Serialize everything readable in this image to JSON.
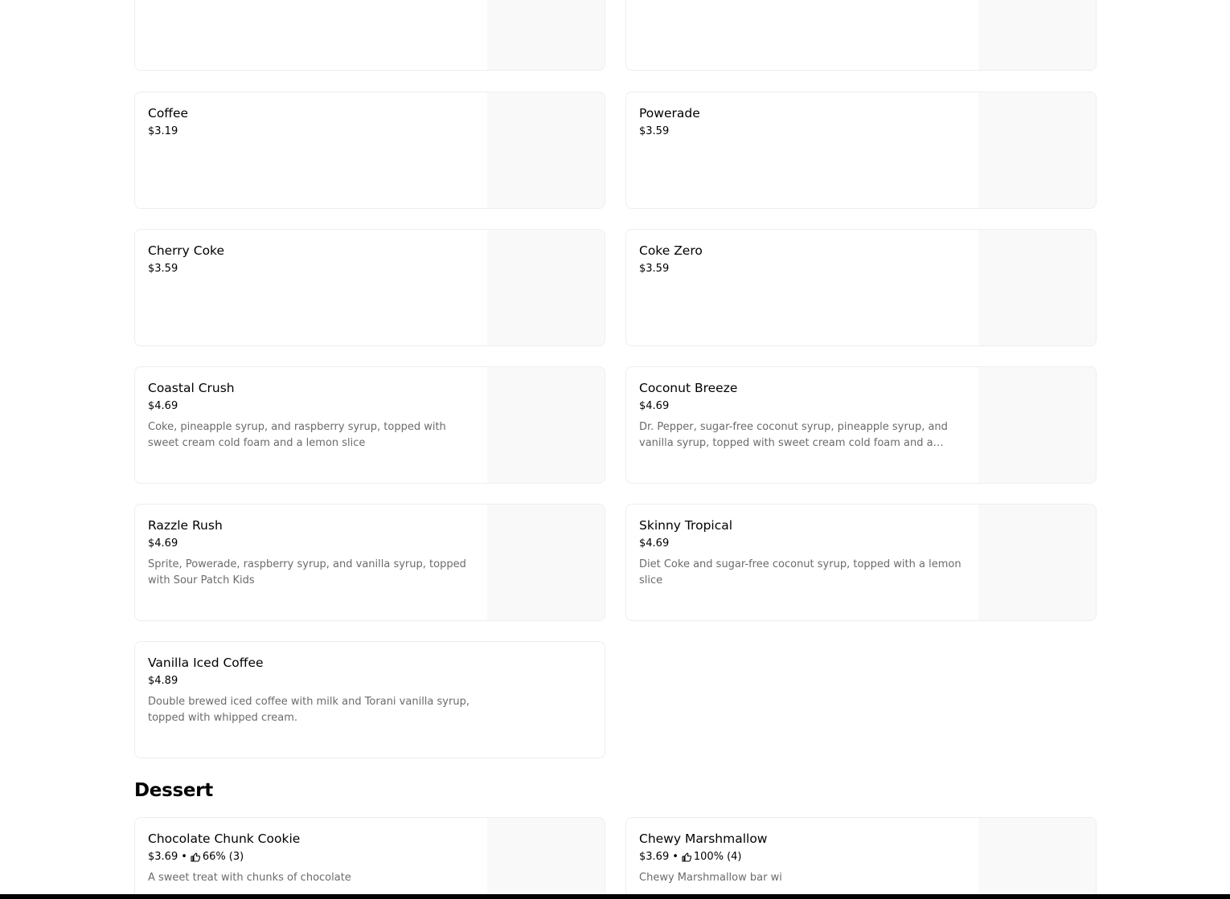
{
  "drinks": [
    {
      "name": "Coffee",
      "price": "$3.19",
      "description": ""
    },
    {
      "name": "Powerade",
      "price": "$3.59",
      "description": ""
    },
    {
      "name": "Cherry Coke",
      "price": "$3.59",
      "description": ""
    },
    {
      "name": "Coke Zero",
      "price": "$3.59",
      "description": ""
    },
    {
      "name": "Coastal Crush",
      "price": "$4.69",
      "description": "Coke, pineapple syrup, and raspberry syrup, topped with sweet cream cold foam and a lemon slice"
    },
    {
      "name": "Coconut Breeze",
      "price": "$4.69",
      "description": "Dr. Pepper, sugar-free coconut syrup, pineapple syrup, and vanilla syrup, topped with sweet cream cold foam and a lemon slice"
    },
    {
      "name": "Razzle Rush",
      "price": "$4.69",
      "description": "Sprite, Powerade, raspberry syrup, and vanilla syrup, topped with Sour Patch Kids"
    },
    {
      "name": "Skinny Tropical",
      "price": "$4.69",
      "description": "Diet Coke and sugar-free coconut syrup, topped with a lemon slice"
    },
    {
      "name": "Vanilla Iced Coffee",
      "price": "$4.89",
      "description": "Double brewed iced coffee with milk and Torani vanilla syrup, topped with whipped cream."
    }
  ],
  "dessert": {
    "title": "Dessert",
    "items": [
      {
        "name": "Chocolate Chunk Cookie",
        "price": "$3.69",
        "separator": "•",
        "rating": "66%",
        "rating_count": "(3)",
        "description": "A sweet treat with chunks of chocolate"
      },
      {
        "name": "Chewy Marshmallow",
        "price": "$3.69",
        "separator": "•",
        "rating": "100%",
        "rating_count": "(4)",
        "description": "Chewy Marshmallow bar wi"
      }
    ]
  },
  "colors": {
    "card_border": "#eeeeee",
    "thumbnail_bg": "#f9f9f9",
    "description_text": "#6b6b6b",
    "bottom_bar": "#000000"
  },
  "icons": {
    "rating": "thumbs-up-icon"
  }
}
